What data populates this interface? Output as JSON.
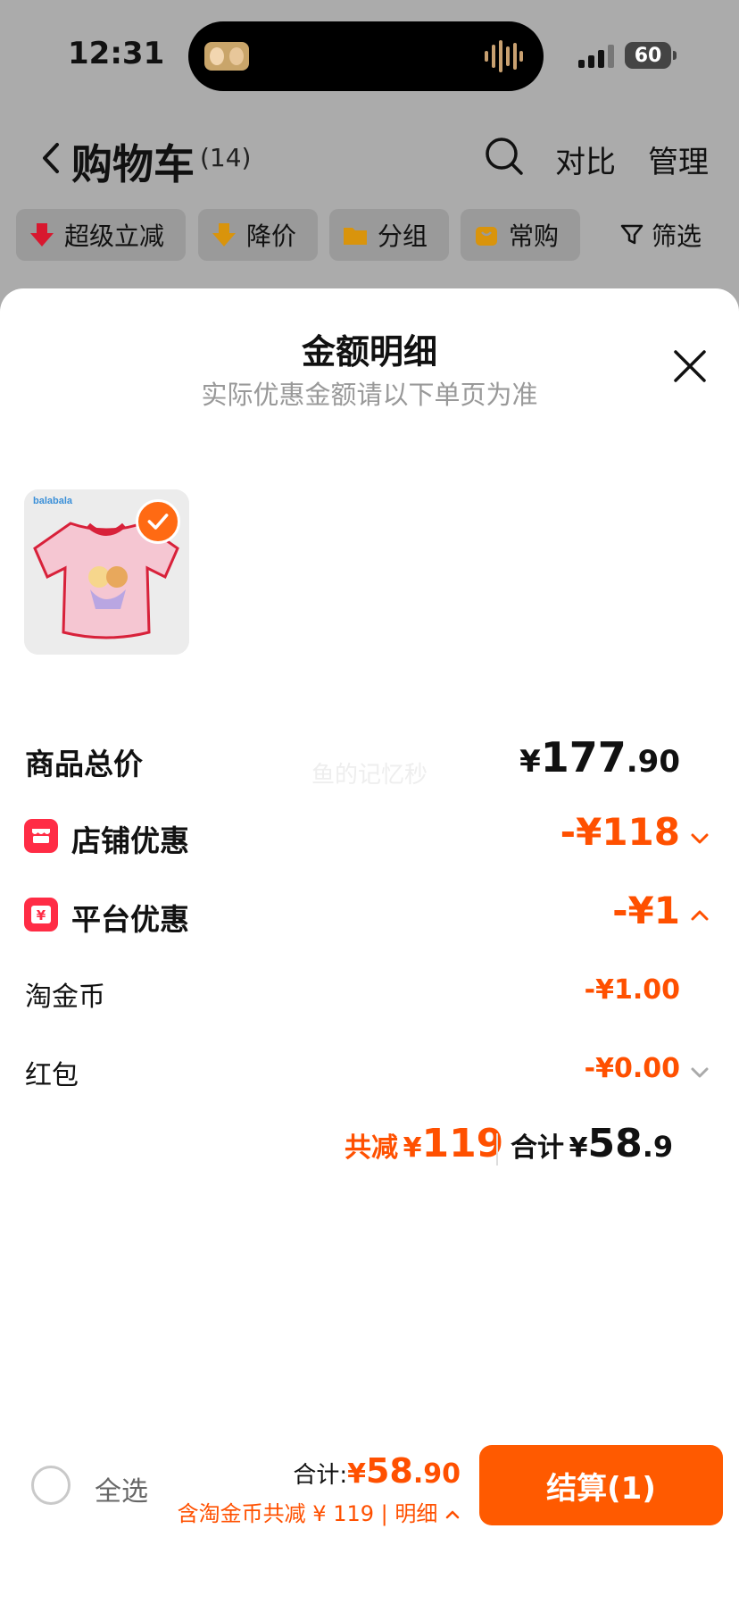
{
  "status_bar": {
    "time": "12:31",
    "battery": "60"
  },
  "header": {
    "title": "购物车",
    "count": "(14)",
    "compare_label": "对比",
    "manage_label": "管理"
  },
  "filters": {
    "chips": [
      {
        "label": "超级立减",
        "icon": "red-down-arrow-icon"
      },
      {
        "label": "降价",
        "icon": "orange-down-arrow-icon"
      },
      {
        "label": "分组",
        "icon": "folder-icon"
      },
      {
        "label": "常购",
        "icon": "shopping-bag-icon"
      }
    ],
    "filter_label": "筛选"
  },
  "sheet": {
    "title": "金额明细",
    "subtitle": "实际优惠金额请以下单页为准",
    "watermark": "鱼的记忆秒",
    "rows": {
      "goods_total": {
        "label": "商品总价",
        "currency": "¥",
        "int": "177",
        "dec": ".90"
      },
      "store_discount": {
        "label": "店铺优惠",
        "value": "-¥118",
        "arrow": "chevron-down"
      },
      "platform_discount": {
        "label": "平台优惠",
        "value": "-¥1",
        "arrow": "chevron-up"
      },
      "taojinbi": {
        "label": "淘金币",
        "value": "-¥1.00"
      },
      "red_packet": {
        "label": "红包",
        "value": "-¥0.00",
        "arrow": "chevron-down"
      }
    },
    "summary": {
      "reduce_label": "共减",
      "reduce_currency": "¥",
      "reduce_value": "119",
      "total_label": "合计",
      "total_currency": "¥",
      "total_int": "58",
      "total_dec": ".9"
    }
  },
  "checkout": {
    "select_all_label": "全选",
    "total_label": "合计:",
    "total_currency": "¥",
    "total_int": "58",
    "total_dec": ".90",
    "savings_text": "含淘金币共减 ¥ 119 | 明细",
    "button_label": "结算(1)"
  },
  "colors": {
    "accent": "#ff5000",
    "button": "#ff5a00",
    "store_icon": "#ff2c45"
  }
}
